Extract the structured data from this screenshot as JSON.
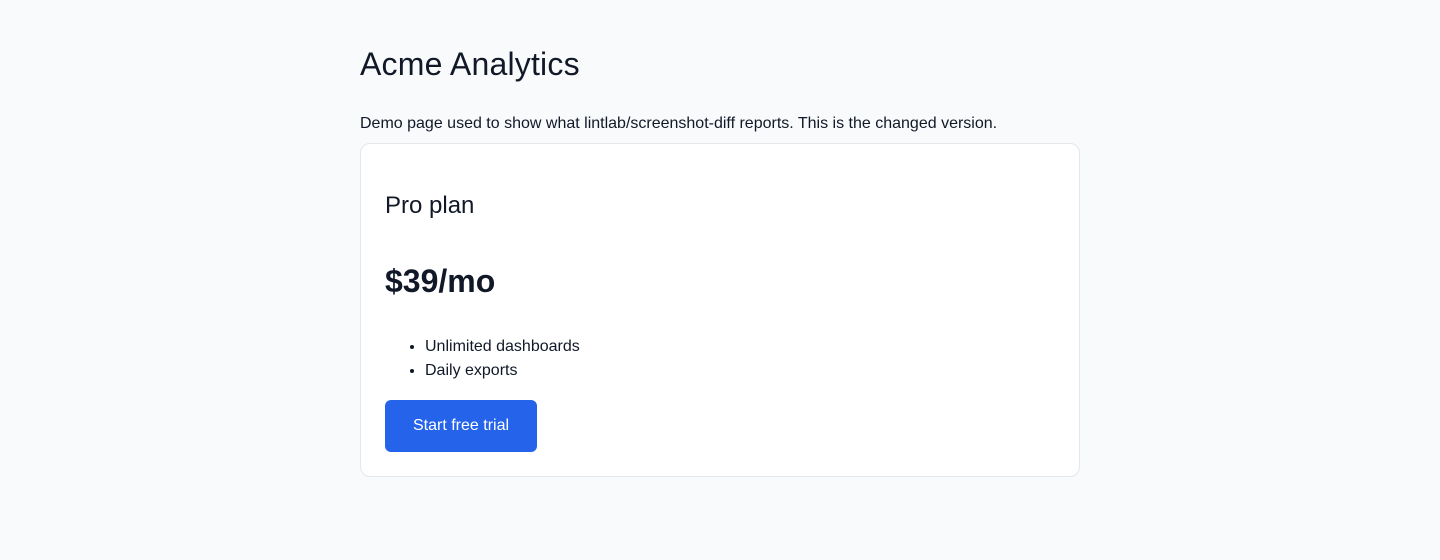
{
  "header": {
    "title": "Acme Analytics",
    "subtitle": "Demo page used to show what lintlab/screenshot-diff reports. This is the changed version."
  },
  "plan_card": {
    "name": "Pro plan",
    "price": "$39/mo",
    "features": [
      "Unlimited dashboards",
      "Daily exports"
    ],
    "cta_label": "Start free trial"
  },
  "colors": {
    "background": "#f8fafc",
    "card_background": "#ffffff",
    "card_border": "#e5e7eb",
    "text": "#111827",
    "accent": "#2563eb",
    "button_text": "#ffffff"
  }
}
